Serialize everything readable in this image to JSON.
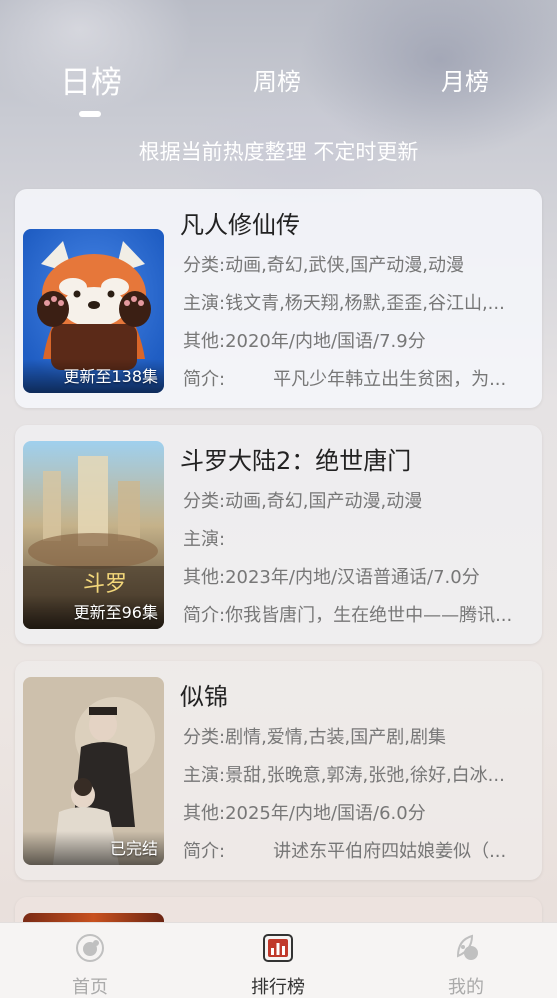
{
  "tabs": [
    {
      "label": "日榜"
    },
    {
      "label": "周榜"
    },
    {
      "label": "月榜"
    }
  ],
  "subtitle": "根据当前热度整理 不定时更新",
  "cards": [
    {
      "title": "凡人修仙传",
      "badge": "更新至138集",
      "category_label": "分类:",
      "category": "动画,奇幻,武侠,国产动漫,动漫",
      "cast_label": "主演:",
      "cast": "钱文青,杨天翔,杨默,歪歪,谷江山,...",
      "other_label": "其他:",
      "other": "2020年/内地/国语/7.9分",
      "intro_label": "简介:",
      "intro": "平凡少年韩立出生贫困，为..."
    },
    {
      "title": "斗罗大陆2：绝世唐门",
      "badge": "更新至96集",
      "category_label": "分类:",
      "category": "动画,奇幻,国产动漫,动漫",
      "cast_label": "主演:",
      "cast": "",
      "other_label": "其他:",
      "other": "2023年/内地/汉语普通话/7.0分",
      "intro_label": "简介:",
      "intro": "你我皆唐门，生在绝世中——腾讯..."
    },
    {
      "title": "似锦",
      "badge": "已完结",
      "category_label": "分类:",
      "category": "剧情,爱情,古装,国产剧,剧集",
      "cast_label": "主演:",
      "cast": "景甜,张晚意,郭涛,张弛,徐好,白冰...",
      "other_label": "其他:",
      "other": "2025年/内地/国语/6.0分",
      "intro_label": "简介:",
      "intro": "讲述东平伯府四姑娘姜似（..."
    }
  ],
  "bottom_nav": [
    {
      "label": "首页",
      "icon": "home-icon"
    },
    {
      "label": "排行榜",
      "icon": "ranking-icon"
    },
    {
      "label": "我的",
      "icon": "profile-icon"
    }
  ],
  "colors": {
    "active_text": "#333333",
    "inactive_text": "#aaaaaa",
    "ranking_icon_red": "#c0392b"
  }
}
